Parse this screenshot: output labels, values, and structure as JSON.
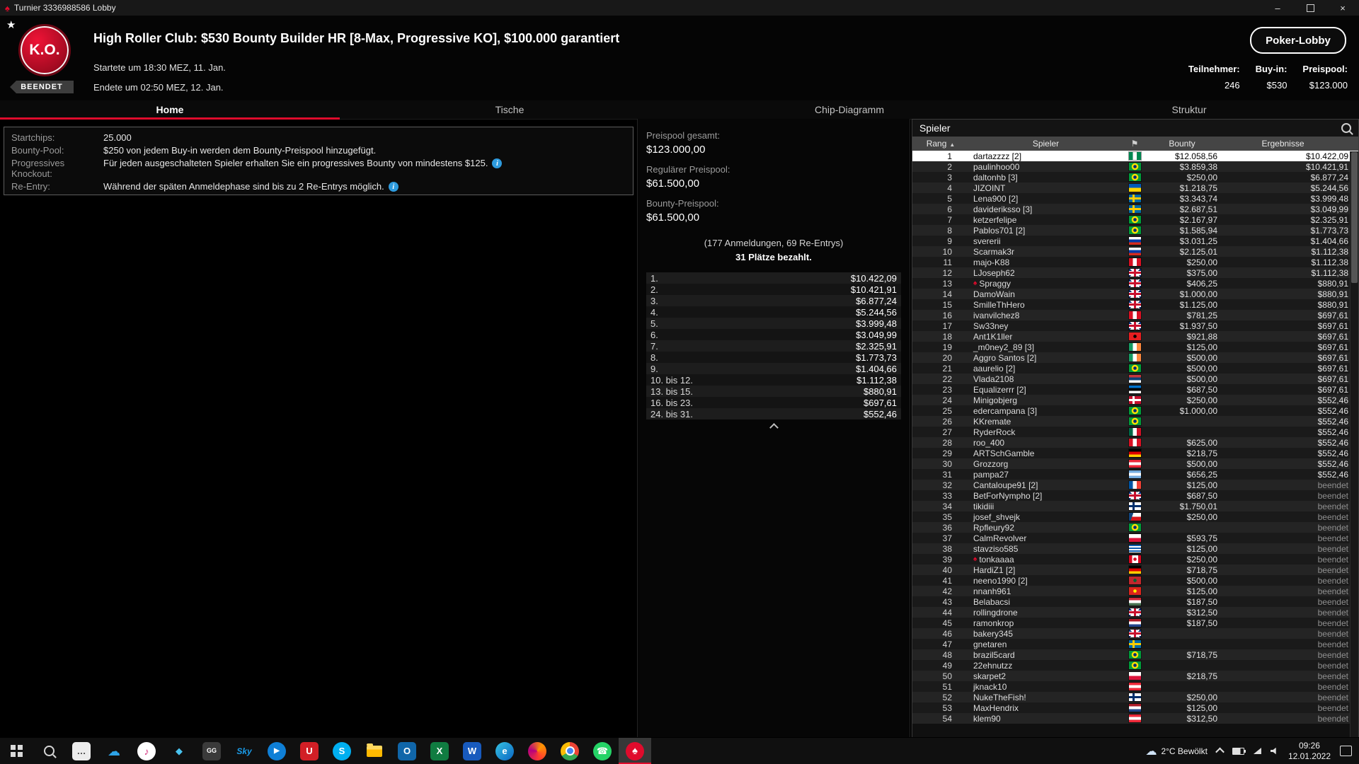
{
  "window": {
    "title": "Turnier 3336988586 Lobby",
    "minimize_icon": "–",
    "close_icon": "×"
  },
  "header": {
    "logo_text": "K.O.",
    "status_badge": "BEENDET",
    "title": "High Roller Club: $530 Bounty Builder HR [8-Max, Progressive KO], $100.000 garantiert",
    "started": "Startete um 18:30 MEZ, 11. Jan.",
    "ended": "Endete um 02:50 MEZ, 12. Jan.",
    "lobby_button": "Poker-Lobby",
    "stats": [
      {
        "label": "Teilnehmer:",
        "value": "246"
      },
      {
        "label": "Buy-in:",
        "value": "$530"
      },
      {
        "label": "Preispool:",
        "value": "$123.000"
      }
    ]
  },
  "tabs": [
    {
      "id": "tab-home",
      "label": "Home",
      "active": true
    },
    {
      "id": "tab-tische",
      "label": "Tische"
    },
    {
      "id": "tab-chip-diagramm",
      "label": "Chip-Diagramm"
    },
    {
      "id": "tab-struktur",
      "label": "Struktur"
    }
  ],
  "info": {
    "rows": [
      {
        "label": "Startchips:",
        "text": "25.000"
      },
      {
        "label": "Bounty-Pool:",
        "text": "$250 von jedem Buy-in werden dem Bounty-Preispool hinzugefügt."
      },
      {
        "label": "Progressives Knockout:",
        "text": "Für jeden ausgeschalteten Spieler erhalten Sie ein progressives Bounty von mindestens $125.",
        "info": true
      },
      {
        "label": "Re-Entry:",
        "text": "Während der späten Anmeldephase sind bis zu 2 Re-Entrys möglich.",
        "info": true
      }
    ],
    "info_icon_glyph": "i"
  },
  "pool": {
    "total_label": "Preispool gesamt:",
    "total_value": "$123.000,00",
    "regular_label": "Regulärer Preispool:",
    "regular_value": "$61.500,00",
    "bounty_label": "Bounty-Preispool:",
    "bounty_value": "$61.500,00",
    "entries": "(177 Anmeldungen, 69 Re-Entrys)",
    "paid": "31 Plätze bezahlt.",
    "payouts": [
      {
        "place": "1.",
        "amount": "$10.422,09"
      },
      {
        "place": "2.",
        "amount": "$10.421,91"
      },
      {
        "place": "3.",
        "amount": "$6.877,24"
      },
      {
        "place": "4.",
        "amount": "$5.244,56"
      },
      {
        "place": "5.",
        "amount": "$3.999,48"
      },
      {
        "place": "6.",
        "amount": "$3.049,99"
      },
      {
        "place": "7.",
        "amount": "$2.325,91"
      },
      {
        "place": "8.",
        "amount": "$1.773,73"
      },
      {
        "place": "9.",
        "amount": "$1.404,66"
      },
      {
        "place": "10. bis 12.",
        "amount": "$1.112,38"
      },
      {
        "place": "13. bis 15.",
        "amount": "$880,91"
      },
      {
        "place": "16. bis 23.",
        "amount": "$697,61"
      },
      {
        "place": "24. bis 31.",
        "amount": "$552,46"
      }
    ]
  },
  "players": {
    "panel_title": "Spieler",
    "columns": {
      "rank": "Rang",
      "sort": "▲",
      "player": "Spieler",
      "flag_icon": "⚑",
      "bounty": "Bounty",
      "result": "Ergebnisse"
    },
    "rows": [
      {
        "rank": "1",
        "name": "dartazzzz [2]",
        "flag": "ng",
        "bounty": "$12.058,56",
        "result": "$10.422,09",
        "sel": true
      },
      {
        "rank": "2",
        "name": "paulinhoo00",
        "flag": "br",
        "bounty": "$3.859,38",
        "result": "$10.421,91"
      },
      {
        "rank": "3",
        "name": "daltonhb [3]",
        "flag": "br",
        "bounty": "$250,00",
        "result": "$6.877,24"
      },
      {
        "rank": "4",
        "name": "JIZOINT",
        "flag": "ua",
        "bounty": "$1.218,75",
        "result": "$5.244,56"
      },
      {
        "rank": "5",
        "name": "Lena900 [2]",
        "flag": "se",
        "bounty": "$3.343,74",
        "result": "$3.999,48"
      },
      {
        "rank": "6",
        "name": "davideriksso [3]",
        "flag": "se",
        "bounty": "$2.687,51",
        "result": "$3.049,99"
      },
      {
        "rank": "7",
        "name": "ketzerfelipe",
        "flag": "br",
        "bounty": "$2.167,97",
        "result": "$2.325,91"
      },
      {
        "rank": "8",
        "name": "Pablos701 [2]",
        "flag": "br",
        "bounty": "$1.585,94",
        "result": "$1.773,73"
      },
      {
        "rank": "9",
        "name": "svererii",
        "flag": "ru",
        "bounty": "$3.031,25",
        "result": "$1.404,66"
      },
      {
        "rank": "10",
        "name": "Scarmak3r",
        "flag": "ru",
        "bounty": "$2.125,01",
        "result": "$1.112,38"
      },
      {
        "rank": "11",
        "name": "majo-K88",
        "flag": "pe",
        "bounty": "$250,00",
        "result": "$1.112,38"
      },
      {
        "rank": "12",
        "name": "LJoseph62",
        "flag": "gb",
        "bounty": "$375,00",
        "result": "$1.112,38"
      },
      {
        "rank": "13",
        "name": "Spraggy",
        "flag": "gb",
        "team": true,
        "bounty": "$406,25",
        "result": "$880,91"
      },
      {
        "rank": "14",
        "name": "DamoWain",
        "flag": "gb",
        "bounty": "$1.000,00",
        "result": "$880,91"
      },
      {
        "rank": "15",
        "name": "SmilleThHero",
        "flag": "gb",
        "bounty": "$1.125,00",
        "result": "$880,91"
      },
      {
        "rank": "16",
        "name": "ivanvilchez8",
        "flag": "pe",
        "bounty": "$781,25",
        "result": "$697,61"
      },
      {
        "rank": "17",
        "name": "Sw33ney",
        "flag": "gb",
        "bounty": "$1.937,50",
        "result": "$697,61"
      },
      {
        "rank": "18",
        "name": "Ant1K1ller",
        "flag": "al",
        "bounty": "$921,88",
        "result": "$697,61"
      },
      {
        "rank": "19",
        "name": "_m0ney2_89 [3]",
        "flag": "ie",
        "bounty": "$125,00",
        "result": "$697,61"
      },
      {
        "rank": "20",
        "name": "Aggro Santos [2]",
        "flag": "ie",
        "bounty": "$500,00",
        "result": "$697,61"
      },
      {
        "rank": "21",
        "name": "aaurelio [2]",
        "flag": "br",
        "bounty": "$500,00",
        "result": "$697,61"
      },
      {
        "rank": "22",
        "name": "Vlada2108",
        "flag": "rs",
        "bounty": "$500,00",
        "result": "$697,61"
      },
      {
        "rank": "23",
        "name": "Equalizerrr [2]",
        "flag": "ee",
        "bounty": "$687,50",
        "result": "$697,61"
      },
      {
        "rank": "24",
        "name": "Minigobjerg",
        "flag": "dk",
        "bounty": "$250,00",
        "result": "$552,46"
      },
      {
        "rank": "25",
        "name": "edercampana [3]",
        "flag": "br",
        "bounty": "$1.000,00",
        "result": "$552,46"
      },
      {
        "rank": "26",
        "name": "KKremate",
        "flag": "br",
        "bounty": "",
        "result": "$552,46"
      },
      {
        "rank": "27",
        "name": "RyderRock",
        "flag": "mx",
        "bounty": "",
        "result": "$552,46"
      },
      {
        "rank": "28",
        "name": "roo_400",
        "flag": "pe",
        "bounty": "$625,00",
        "result": "$552,46"
      },
      {
        "rank": "29",
        "name": "ARTSchGamble",
        "flag": "de",
        "bounty": "$218,75",
        "result": "$552,46"
      },
      {
        "rank": "30",
        "name": "Grozzorg",
        "flag": "at",
        "bounty": "$500,00",
        "result": "$552,46"
      },
      {
        "rank": "31",
        "name": "pampa27",
        "flag": "ar",
        "bounty": "$656,25",
        "result": "$552,46"
      },
      {
        "rank": "32",
        "name": "Cantaloupe91 [2]",
        "flag": "fr",
        "bounty": "$125,00",
        "result": "beendet",
        "done": true
      },
      {
        "rank": "33",
        "name": "BetForNympho [2]",
        "flag": "gb",
        "bounty": "$687,50",
        "result": "beendet",
        "done": true
      },
      {
        "rank": "34",
        "name": "tikidiii",
        "flag": "fi",
        "bounty": "$1.750,01",
        "result": "beendet",
        "done": true
      },
      {
        "rank": "35",
        "name": "josef_shvejk",
        "flag": "cz",
        "bounty": "$250,00",
        "result": "beendet",
        "done": true
      },
      {
        "rank": "36",
        "name": "Rpfleury92",
        "flag": "br",
        "bounty": "",
        "result": "beendet",
        "done": true
      },
      {
        "rank": "37",
        "name": "CalmRevolver",
        "flag": "pl",
        "bounty": "$593,75",
        "result": "beendet",
        "done": true
      },
      {
        "rank": "38",
        "name": "stavziso585",
        "flag": "gr",
        "bounty": "$125,00",
        "result": "beendet",
        "done": true
      },
      {
        "rank": "39",
        "name": "tonkaaaa",
        "flag": "ca",
        "team": true,
        "bounty": "$250,00",
        "result": "beendet",
        "done": true
      },
      {
        "rank": "40",
        "name": "HardiZ1 [2]",
        "flag": "de",
        "bounty": "$718,75",
        "result": "beendet",
        "done": true
      },
      {
        "rank": "41",
        "name": "neeno1990 [2]",
        "flag": "ma",
        "bounty": "$500,00",
        "result": "beendet",
        "done": true
      },
      {
        "rank": "42",
        "name": "nnanh961",
        "flag": "vn",
        "bounty": "$125,00",
        "result": "beendet",
        "done": true
      },
      {
        "rank": "43",
        "name": "Belabacsi",
        "flag": "hu",
        "bounty": "$187,50",
        "result": "beendet",
        "done": true
      },
      {
        "rank": "44",
        "name": "rollingdrone",
        "flag": "gb",
        "bounty": "$312,50",
        "result": "beendet",
        "done": true
      },
      {
        "rank": "45",
        "name": "ramonkrop",
        "flag": "nl",
        "bounty": "$187,50",
        "result": "beendet",
        "done": true
      },
      {
        "rank": "46",
        "name": "bakery345",
        "flag": "gb",
        "bounty": "",
        "result": "beendet",
        "done": true
      },
      {
        "rank": "47",
        "name": "gnetaren",
        "flag": "se",
        "bounty": "",
        "result": "beendet",
        "done": true
      },
      {
        "rank": "48",
        "name": "brazil5card",
        "flag": "br",
        "bounty": "$718,75",
        "result": "beendet",
        "done": true
      },
      {
        "rank": "49",
        "name": "22ehnutzz",
        "flag": "br",
        "bounty": "",
        "result": "beendet",
        "done": true
      },
      {
        "rank": "50",
        "name": "skarpet2",
        "flag": "pl",
        "bounty": "$218,75",
        "result": "beendet",
        "done": true
      },
      {
        "rank": "51",
        "name": "jknack10",
        "flag": "at",
        "bounty": "",
        "result": "beendet",
        "done": true
      },
      {
        "rank": "52",
        "name": "NukeTheFish!",
        "flag": "fi",
        "bounty": "$250,00",
        "result": "beendet",
        "done": true
      },
      {
        "rank": "53",
        "name": "MaxHendrix",
        "flag": "nl",
        "bounty": "$125,00",
        "result": "beendet",
        "done": true
      },
      {
        "rank": "54",
        "name": "klem90",
        "flag": "at",
        "bounty": "$312,50",
        "result": "beendet",
        "done": true
      }
    ]
  },
  "taskbar": {
    "icons": [
      {
        "id": "start-icon",
        "kind": "start"
      },
      {
        "id": "search-icon",
        "kind": "search"
      },
      {
        "id": "chat-icon",
        "glyph": "…",
        "bg": "#ececec",
        "fg": "#444"
      },
      {
        "id": "cloud-app-icon",
        "kind": "cloudapp",
        "glyph": "☁",
        "bg": "transparent",
        "fg": "#2da3e8"
      },
      {
        "id": "music-icon",
        "kind": "music",
        "glyph": "♪",
        "bg": "#ffffff",
        "fg": "#d6317f",
        "shape": "circle"
      },
      {
        "id": "dev-diamond-icon",
        "kind": "dev",
        "glyph": "◆",
        "bg": "transparent",
        "fg": "#49c3ef"
      },
      {
        "id": "gg-icon",
        "kind": "gg",
        "glyph": "GG",
        "bg": "#3a3a3a",
        "fg": "#ffffff"
      },
      {
        "id": "sky-icon",
        "kind": "sky",
        "glyph": "Sky",
        "bg": "transparent",
        "fg": "#1a9be8"
      },
      {
        "id": "video-icon",
        "kind": "video",
        "glyph": "▶",
        "bg": "#0f7fd6",
        "fg": "#ffffff",
        "shape": "circle"
      },
      {
        "id": "u-app-icon",
        "glyph": "U",
        "bg": "#d21f26",
        "fg": "#ffffff"
      },
      {
        "id": "skype-icon",
        "glyph": "S",
        "bg": "#00aff0",
        "fg": "#ffffff",
        "shape": "circle"
      },
      {
        "id": "file-explorer-icon",
        "kind": "folder"
      },
      {
        "id": "outlook-icon",
        "glyph": "O",
        "bg": "#1066a9",
        "fg": "#ffffff"
      },
      {
        "id": "excel-icon",
        "glyph": "X",
        "bg": "#107c41",
        "fg": "#ffffff"
      },
      {
        "id": "word-icon",
        "glyph": "W",
        "bg": "#185abd",
        "fg": "#ffffff"
      },
      {
        "id": "edge-icon",
        "glyph": "e",
        "bg": "linear-gradient(135deg,#35c2e2,#0b66c3)",
        "fg": "#ffffff",
        "shape": "circle"
      },
      {
        "id": "firefox-icon",
        "glyph": "",
        "bg": "conic-gradient(from 40deg,#ff9500,#ff3b30,#b5007f,#ff9500)",
        "shape": "circle"
      },
      {
        "id": "chrome-icon",
        "kind": "chrome",
        "glyph": "",
        "bg": "conic-gradient(#ea4335 0 120deg,#34a853 120deg 240deg,#fbbc05 240deg 360deg)",
        "shape": "circle"
      },
      {
        "id": "whatsapp-icon",
        "kind": "whatsapp",
        "glyph": "☎",
        "bg": "#25d366",
        "fg": "#ffffff",
        "shape": "circle"
      },
      {
        "id": "pokerstars-icon",
        "kind": "pokerstars",
        "glyph": "♠",
        "bg": "#e00b2c",
        "fg": "#ffffff",
        "shape": "circle",
        "active": true
      }
    ],
    "weather": {
      "icon_glyph": "☁",
      "text": "2°C Bewölkt"
    },
    "clock": {
      "time": "09:26",
      "date": "12.01.2022"
    }
  }
}
